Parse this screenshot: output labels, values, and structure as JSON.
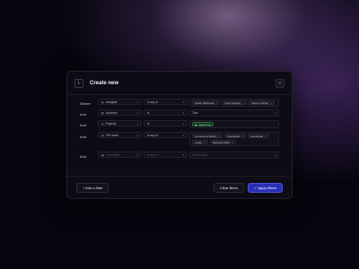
{
  "header": {
    "title": "Create new",
    "left_icon": "L",
    "right_icon": "≡"
  },
  "rows": [
    {
      "conj": "Where",
      "field": "Assignee",
      "op": "is any of",
      "chips": [
        "Austin McDaniel",
        "Kyle Chapple",
        "Laura Lochstp"
      ]
    },
    {
      "conj": "And",
      "field": "Archived",
      "op": "is",
      "value": "True"
    },
    {
      "conj": "And",
      "field": "Property",
      "op": "is",
      "chips_green": [
        "Figma File"
      ]
    },
    {
      "conj": "And",
      "field": "File name",
      "op": "is any of",
      "chips": [
        "Component library",
        "Newsletter",
        "Goodcode",
        "Crafty",
        "Rebrand 2023"
      ]
    },
    {
      "conj": "And",
      "field_placeholder": "Select filter",
      "op_placeholder": "is any of",
      "value_placeholder": "Select value"
    }
  ],
  "footer": {
    "add": "Add a filter",
    "clear": "Clear filters",
    "apply": "Apply filters"
  },
  "colors": {
    "primary": "#2a2fb5",
    "accent_green": "#8fe0a0"
  }
}
